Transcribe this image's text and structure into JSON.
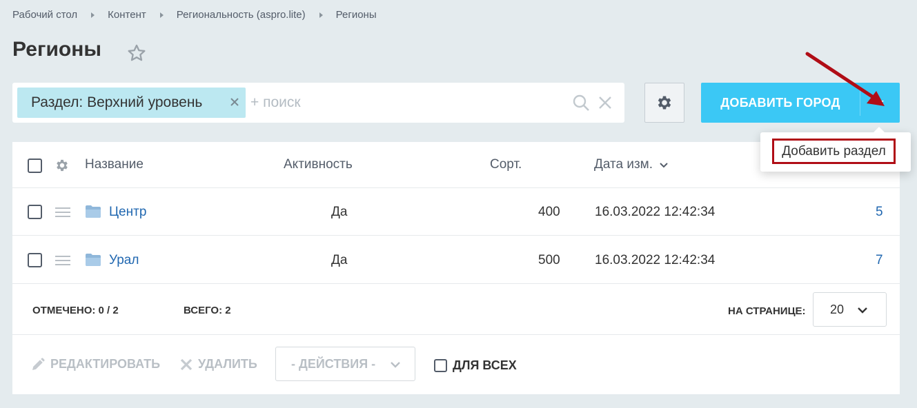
{
  "breadcrumb": {
    "items": [
      "Рабочий стол",
      "Контент",
      "Региональность (aspro.lite)",
      "Регионы"
    ]
  },
  "page": {
    "title": "Регионы"
  },
  "filter": {
    "chip_label": "Раздел: Верхний уровень",
    "search_placeholder": "+ поиск"
  },
  "toolbar": {
    "add_label": "ДОБАВИТЬ ГОРОД"
  },
  "dropdown": {
    "item_label": "Добавить раздел"
  },
  "table": {
    "headers": {
      "name": "Название",
      "active": "Активность",
      "sort": "Сорт.",
      "date": "Дата изм."
    },
    "rows": [
      {
        "name": "Центр",
        "active": "Да",
        "sort": "400",
        "date": "16.03.2022 12:42:34",
        "id": "5"
      },
      {
        "name": "Урал",
        "active": "Да",
        "sort": "500",
        "date": "16.03.2022 12:42:34",
        "id": "7"
      }
    ]
  },
  "footer": {
    "checked_label": "ОТМЕЧЕНО:",
    "checked_value": "0 / 2",
    "total_label": "ВСЕГО:",
    "total_value": "2",
    "per_page_label": "НА СТРАНИЦЕ:",
    "per_page_value": "20"
  },
  "actions": {
    "edit_label": "РЕДАКТИРОВАТЬ",
    "delete_label": "УДАЛИТЬ",
    "select_label": "- ДЕЙСТВИЯ -",
    "for_all_label": "ДЛЯ ВСЕХ"
  },
  "colors": {
    "accent": "#3bc8f5",
    "chip": "#bce8f1",
    "link": "#2067b0",
    "highlight": "#b00d16",
    "background": "#e4ebee"
  },
  "icons": [
    "star-icon",
    "close-icon",
    "search-icon",
    "gear-icon",
    "chevron-down-icon",
    "folder-icon",
    "drag-handle-icon",
    "pencil-icon",
    "arrow-annotation"
  ]
}
